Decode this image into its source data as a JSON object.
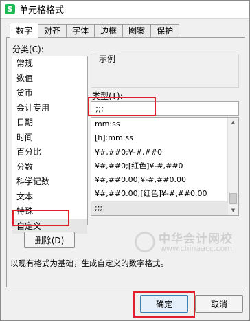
{
  "window": {
    "icon_glyph": "S",
    "title": "单元格格式"
  },
  "tabs": [
    {
      "label": "数字",
      "active": true
    },
    {
      "label": "对齐"
    },
    {
      "label": "字体"
    },
    {
      "label": "边框"
    },
    {
      "label": "图案"
    },
    {
      "label": "保护"
    }
  ],
  "category": {
    "label": "分类(C):",
    "items": [
      "常规",
      "数值",
      "货币",
      "会计专用",
      "日期",
      "时间",
      "百分比",
      "分数",
      "科学记数",
      "文本",
      "特殊",
      "自定义"
    ],
    "selected": "自定义"
  },
  "sample": {
    "label": "示例",
    "value": ""
  },
  "type_field": {
    "label": "类型(T):",
    "value": ";;;"
  },
  "format_list": {
    "items": [
      "mm:ss",
      "[h]:mm:ss",
      "¥#,##0;¥-#,##0",
      "¥#,##0;[红色]¥-#,##0",
      "¥#,##0.00;¥-#,##0.00",
      "¥#,##0.00;[红色]¥-#,##0.00",
      ";;;"
    ],
    "selected": ";;;"
  },
  "buttons": {
    "delete": "删除(D)",
    "ok": "确定",
    "cancel": "取消"
  },
  "description": "以现有格式为基础，生成自定义的数字格式。",
  "watermark": {
    "title": "中华会计网校",
    "url": "www.chinaacc.com"
  },
  "colors": {
    "highlight_box": "#e0202c",
    "app_icon": "#1db954"
  },
  "icons": {
    "scroll_up": "▲",
    "scroll_down": "▼"
  }
}
